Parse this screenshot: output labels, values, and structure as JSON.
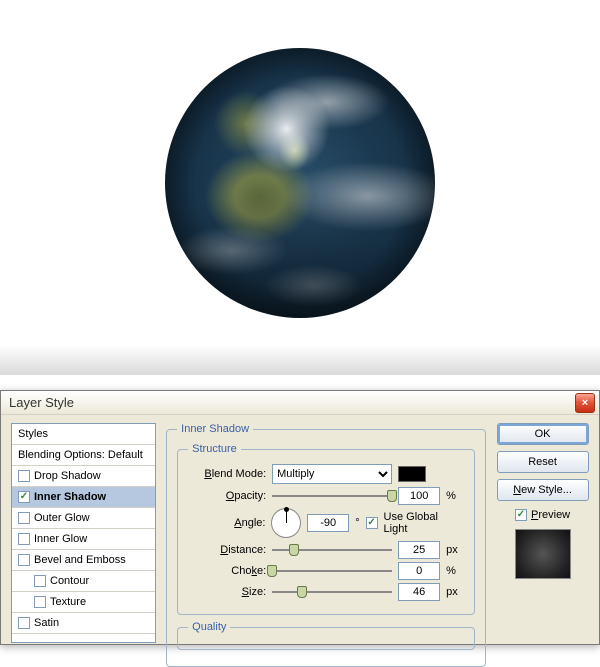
{
  "dialog": {
    "title": "Layer Style",
    "close_label": "×"
  },
  "styles_panel": {
    "header": "Styles",
    "blending": "Blending Options: Default",
    "items": [
      {
        "label": "Drop Shadow",
        "checked": false,
        "selected": false
      },
      {
        "label": "Inner Shadow",
        "checked": true,
        "selected": true
      },
      {
        "label": "Outer Glow",
        "checked": false,
        "selected": false
      },
      {
        "label": "Inner Glow",
        "checked": false,
        "selected": false
      },
      {
        "label": "Bevel and Emboss",
        "checked": false,
        "selected": false
      },
      {
        "label": "Contour",
        "checked": false,
        "selected": false,
        "sub": true
      },
      {
        "label": "Texture",
        "checked": false,
        "selected": false,
        "sub": true
      },
      {
        "label": "Satin",
        "checked": false,
        "selected": false
      }
    ]
  },
  "settings": {
    "group_title": "Inner Shadow",
    "structure_title": "Structure",
    "quality_title": "Quality",
    "blend_mode_label": "Blend Mode:",
    "blend_mode_value": "Multiply",
    "color": "#000000",
    "opacity_label": "Opacity:",
    "opacity_value": "100",
    "opacity_unit": "%",
    "angle_label": "Angle:",
    "angle_value": "-90",
    "angle_unit": "°",
    "global_light_label": "Use Global Light",
    "global_light_checked": true,
    "distance_label": "Distance:",
    "distance_value": "25",
    "distance_unit": "px",
    "choke_label": "Choke:",
    "choke_value": "0",
    "choke_unit": "%",
    "size_label": "Size:",
    "size_value": "46",
    "size_unit": "px"
  },
  "buttons": {
    "ok": "OK",
    "reset": "Reset",
    "new_style": "New Style...",
    "preview_label": "Preview"
  }
}
